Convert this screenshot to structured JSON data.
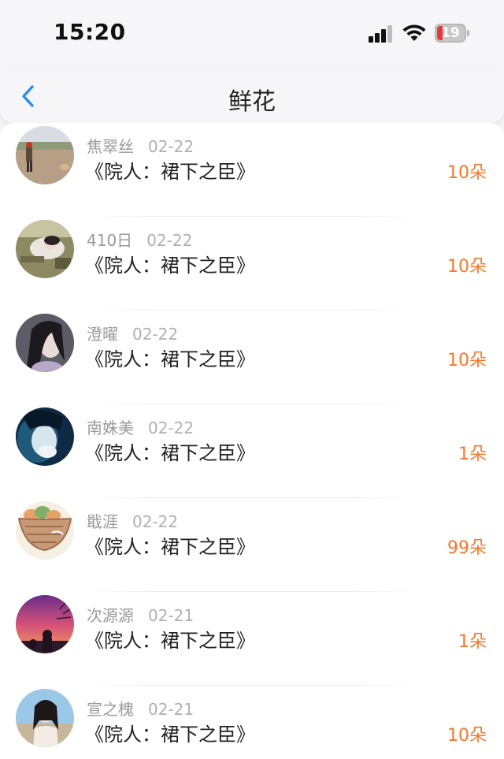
{
  "status_bar": {
    "time": "15:20",
    "battery_level": "19",
    "battery_color": "#e23b3b"
  },
  "nav": {
    "title": "鲜花",
    "back_icon": "chevron-left-icon",
    "accent": "#2f8cf0"
  },
  "list": {
    "count_color": "#f5782d",
    "items": [
      {
        "user": "焦翠丝",
        "date": "02-22",
        "book": "《院人：裙下之臣》",
        "count": "10朵",
        "avatar": "avatar-photo-outdoor"
      },
      {
        "user": "410日",
        "date": "02-22",
        "book": "《院人：裙下之臣》",
        "count": "10朵",
        "avatar": "avatar-photo-girl-lying"
      },
      {
        "user": "澄曜",
        "date": "02-22",
        "book": "《院人：裙下之臣》",
        "count": "10朵",
        "avatar": "avatar-photo-dark-hair"
      },
      {
        "user": "南姝美",
        "date": "02-22",
        "book": "《院人：裙下之臣》",
        "count": "1朵",
        "avatar": "avatar-photo-blue"
      },
      {
        "user": "戢涯",
        "date": "02-22",
        "book": "《院人：裙下之臣》",
        "count": "99朵",
        "avatar": "avatar-illustration-basket"
      },
      {
        "user": "次源源",
        "date": "02-21",
        "book": "《院人：裙下之臣》",
        "count": "1朵",
        "avatar": "avatar-photo-sunset"
      },
      {
        "user": "宣之槐",
        "date": "02-21",
        "book": "《院人：裙下之臣》",
        "count": "10朵",
        "avatar": "avatar-photo-girl-sky"
      }
    ]
  }
}
